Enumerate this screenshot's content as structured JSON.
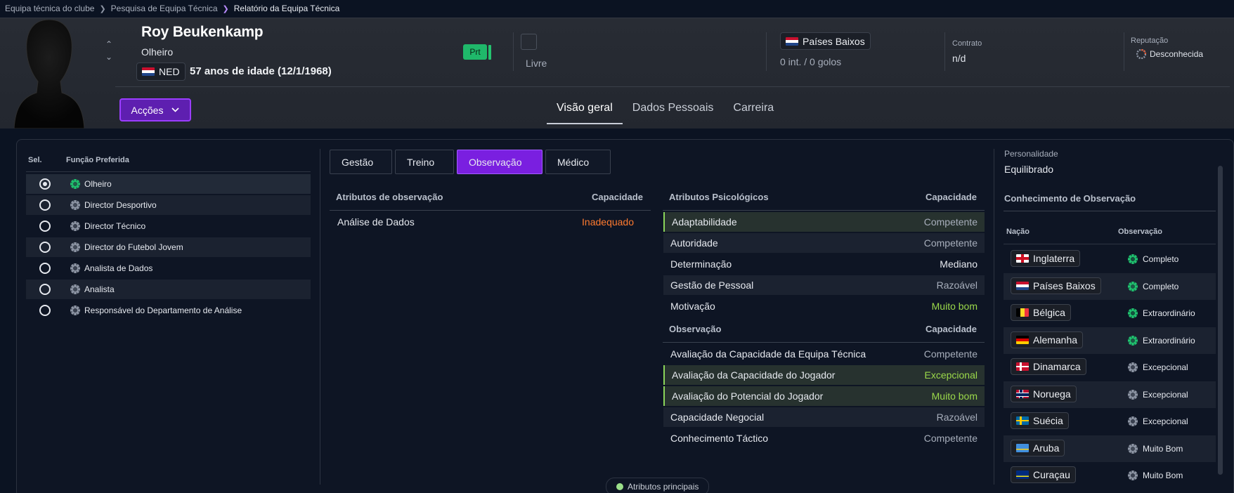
{
  "breadcrumb": {
    "items": [
      "Equipa técnica do clube",
      "Pesquisa de Equipa Técnica"
    ],
    "current": "Relatório da Equipa Técnica"
  },
  "person": {
    "name": "Roy Beukenkamp",
    "role": "Olheiro",
    "nationality_code": "NED",
    "age_text": "57 anos de idade (12/1/1968)",
    "badge": "Prt",
    "status": "Livre",
    "country": "Países Baixos",
    "international": "0 int. / 0 golos",
    "contract_label": "Contrato",
    "contract_value": "n/d",
    "reputation_label": "Reputação",
    "reputation_value": "Desconhecida"
  },
  "actions_label": "Acções",
  "main_tabs": [
    "Visão geral",
    "Dados Pessoais",
    "Carreira"
  ],
  "roles": {
    "header_sel": "Sel.",
    "header_role": "Função Preferida",
    "items": [
      {
        "label": "Olheiro",
        "selected": true,
        "icon": "green"
      },
      {
        "label": "Director Desportivo",
        "selected": false,
        "icon": "grey"
      },
      {
        "label": "Director Técnico",
        "selected": false,
        "icon": "grey"
      },
      {
        "label": "Director do Futebol Jovem",
        "selected": false,
        "icon": "grey"
      },
      {
        "label": "Analista de Dados",
        "selected": false,
        "icon": "grey"
      },
      {
        "label": "Analista",
        "selected": false,
        "icon": "grey"
      },
      {
        "label": "Responsável do Departamento de Análise",
        "selected": false,
        "icon": "grey"
      }
    ]
  },
  "sub_tabs": [
    "Gestão",
    "Treino",
    "Observação",
    "Médico"
  ],
  "scouting_attrs": {
    "header": "Atributos de observação",
    "cap_header": "Capacidade",
    "rows": [
      {
        "label": "Análise de Dados",
        "value": "Inadequado"
      }
    ]
  },
  "psych_attrs": {
    "header": "Atributos Psicológicos",
    "cap_header": "Capacidade",
    "rows": [
      {
        "label": "Adaptabilidade",
        "value": "Competente"
      },
      {
        "label": "Autoridade",
        "value": "Competente"
      },
      {
        "label": "Determinação",
        "value": "Mediano"
      },
      {
        "label": "Gestão de Pessoal",
        "value": "Razoável"
      },
      {
        "label": "Motivação",
        "value": "Muito bom"
      }
    ]
  },
  "obs_attrs": {
    "header": "Observação",
    "cap_header": "Capacidade",
    "rows": [
      {
        "label": "Avaliação da Capacidade da Equipa Técnica",
        "value": "Competente"
      },
      {
        "label": "Avaliação da Capacidade do Jogador",
        "value": "Excepcional"
      },
      {
        "label": "Avaliação do Potencial do Jogador",
        "value": "Muito bom"
      },
      {
        "label": "Capacidade Negocial",
        "value": "Razoável"
      },
      {
        "label": "Conhecimento Táctico",
        "value": "Competente"
      }
    ]
  },
  "personality": {
    "label": "Personalidade",
    "value": "Equilibrado"
  },
  "knowledge": {
    "title": "Conhecimento de Observação",
    "col_nation": "Nação",
    "col_obs": "Observação",
    "rows": [
      {
        "nation": "Inglaterra",
        "flag": "en",
        "level": "Completo",
        "icon": "green"
      },
      {
        "nation": "Países Baixos",
        "flag": "nl",
        "level": "Completo",
        "icon": "green"
      },
      {
        "nation": "Bélgica",
        "flag": "be",
        "level": "Extraordinário",
        "icon": "green"
      },
      {
        "nation": "Alemanha",
        "flag": "de",
        "level": "Extraordinário",
        "icon": "green"
      },
      {
        "nation": "Dinamarca",
        "flag": "dk",
        "level": "Excepcional",
        "icon": "grey"
      },
      {
        "nation": "Noruega",
        "flag": "no",
        "level": "Excepcional",
        "icon": "grey"
      },
      {
        "nation": "Suécia",
        "flag": "se",
        "level": "Excepcional",
        "icon": "grey"
      },
      {
        "nation": "Aruba",
        "flag": "aw",
        "level": "Muito Bom",
        "icon": "grey"
      },
      {
        "nation": "Curaçau",
        "flag": "cw",
        "level": "Muito Bom",
        "icon": "grey"
      }
    ]
  },
  "footer_pill": "Atributos principais",
  "colors": {
    "accent": "#7a1fe0",
    "green": "#1fb86a",
    "orange": "#ff7a2f",
    "light_green": "#9bd94a"
  }
}
